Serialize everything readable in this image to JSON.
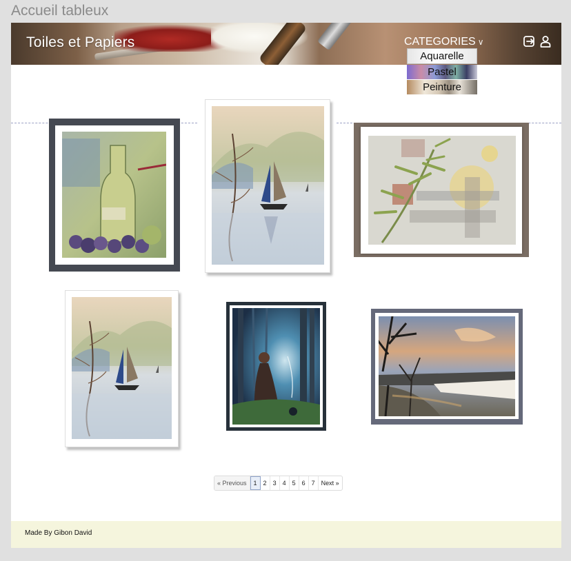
{
  "page": {
    "heading": "Accueil tableux"
  },
  "header": {
    "brand": "Toiles et Papiers",
    "categories_label": "CATEGORIES",
    "categories_chevron": "∨"
  },
  "categories_menu": {
    "items": [
      {
        "label": "Aquarelle"
      },
      {
        "label": "Pastel"
      },
      {
        "label": "Peinture"
      }
    ]
  },
  "gallery": {
    "items": [
      {
        "subject": "wine bottle with grapes",
        "frame_color": "#454952"
      },
      {
        "subject": "junk sailboat watercolor",
        "frame_color": "#ffffff"
      },
      {
        "subject": "bamboo abstract",
        "frame_color": "#7a6d63"
      },
      {
        "subject": "junk sailboat watercolor",
        "frame_color": "#ffffff"
      },
      {
        "subject": "forest witch",
        "frame_color": "#27313a"
      },
      {
        "subject": "winter sunset river",
        "frame_color": "#65697a"
      }
    ]
  },
  "pagination": {
    "previous": "« Previous",
    "pages": [
      "1",
      "2",
      "3",
      "4",
      "5",
      "6",
      "7"
    ],
    "current": "1",
    "next": "Next »"
  },
  "footer": {
    "credit": "Made By Gibon David"
  },
  "icons": {
    "logout": "logout-icon",
    "user": "user-icon"
  },
  "colors": {
    "footer_bg": "#f5f5dd",
    "page_bg": "#e0e0e0"
  }
}
